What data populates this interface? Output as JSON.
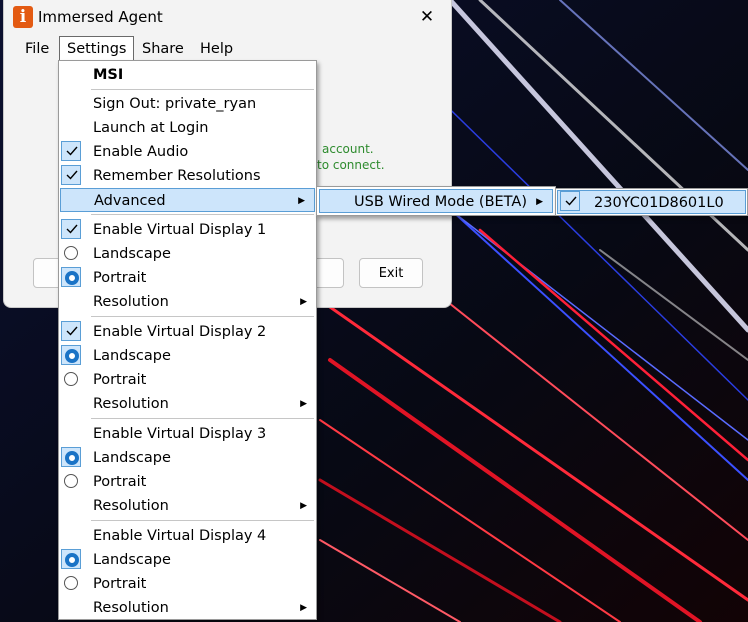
{
  "window": {
    "title": "Immersed Agent",
    "app_icon_letter": "i",
    "close_glyph": "✕",
    "menubar": [
      "File",
      "Settings",
      "Share",
      "Help"
    ],
    "info_line1": "account.",
    "info_line2": "to connect.",
    "exit_label": "Exit"
  },
  "settings_menu": {
    "header": "MSI",
    "items": [
      {
        "label": "Sign Out: private_ryan"
      },
      {
        "label": "Launch at Login"
      },
      {
        "label": "Enable Audio",
        "checked": true
      },
      {
        "label": "Remember Resolutions",
        "checked": true
      },
      {
        "label": "Advanced",
        "submenu": true,
        "highlighted": true
      }
    ],
    "displays": [
      {
        "label": "Enable Virtual Display 1",
        "enabled": true,
        "landscape": "Landscape",
        "portrait": "Portrait",
        "orientation": "portrait",
        "resolution": "Resolution"
      },
      {
        "label": "Enable Virtual Display 2",
        "enabled": true,
        "landscape": "Landscape",
        "portrait": "Portrait",
        "orientation": "landscape",
        "resolution": "Resolution"
      },
      {
        "label": "Enable Virtual Display 3",
        "enabled": false,
        "landscape": "Landscape",
        "portrait": "Portrait",
        "orientation": "landscape",
        "resolution": "Resolution"
      },
      {
        "label": "Enable Virtual Display 4",
        "enabled": false,
        "landscape": "Landscape",
        "portrait": "Portrait",
        "orientation": "landscape",
        "resolution": "Resolution"
      }
    ]
  },
  "advanced_submenu": {
    "item": "USB Wired Mode (BETA)"
  },
  "usb_submenu": {
    "item": "230YC01D8601L0",
    "checked": true
  },
  "colors": {
    "accent": "#1a73c6",
    "highlight": "#cde5fb",
    "info_green": "#2e8b2e"
  }
}
